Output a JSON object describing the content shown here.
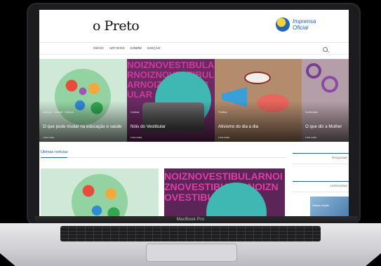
{
  "device": {
    "model_label": "MacBook Pro"
  },
  "site": {
    "logo_text": "o Preto",
    "partner_line1": "Imprensa",
    "partner_line2": "Oficial"
  },
  "nav": {
    "items": [
      "INÍCIO",
      "ARTIGOS",
      "SOBRE",
      "EDIÇÃO"
    ]
  },
  "slider": [
    {
      "category": "Ciência · Cidade · Cultura",
      "title": "O que pode mudar na educação e saúde",
      "more": "Leia mais"
    },
    {
      "category": "Cultura",
      "title": "Nóis do Vestibular",
      "more": "Leia mais"
    },
    {
      "category": "Política",
      "title": "Ativismo do dia a dia",
      "more": "Leia mais"
    },
    {
      "category": "Sociedade",
      "title": "O que diz a Mulher",
      "more": "Leia mais"
    }
  ],
  "slide_art": {
    "wordwall": "NOIZNOVESTIBULARNOIZNOVESTIBULARNOIZNOVESTIBULAR"
  },
  "news": {
    "heading": "Últimas notícias",
    "card_wordwall": "NOIZNOVESTIBULARNOIZNOVESTIBULARNOIZNOVESTIBULAR"
  },
  "sidebar": {
    "box1_label": "PESQUISAR",
    "box2_label": "CATEGORIAS",
    "thumb_text": "Última edição"
  }
}
